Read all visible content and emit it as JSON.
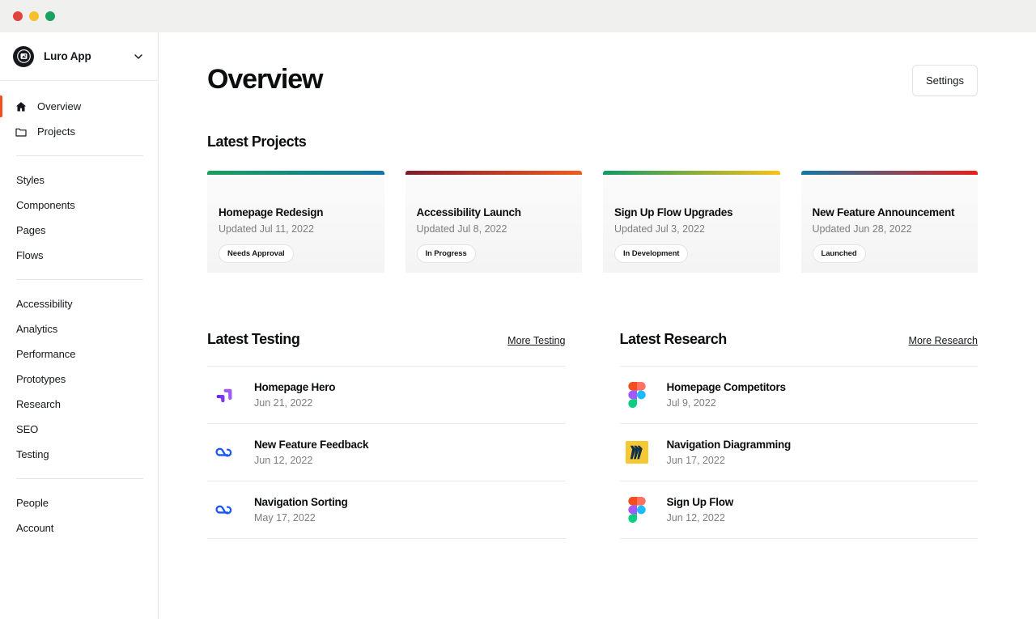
{
  "window": {
    "traffic_lights": [
      "close",
      "minimize",
      "zoom"
    ],
    "colors": {
      "close": "#e0443e",
      "minimize": "#f6c02c",
      "zoom": "#1aa260"
    }
  },
  "sidebar": {
    "brand": {
      "name": "Luro App",
      "logo_icon": "luro-logo-icon",
      "chevron_icon": "chevron-down-icon"
    },
    "primary": [
      {
        "label": "Overview",
        "icon": "home-icon",
        "active": true
      },
      {
        "label": "Projects",
        "icon": "folder-icon",
        "active": false
      }
    ],
    "design_group": [
      {
        "label": "Styles"
      },
      {
        "label": "Components"
      },
      {
        "label": "Pages"
      },
      {
        "label": "Flows"
      }
    ],
    "insights_group": [
      {
        "label": "Accessibility"
      },
      {
        "label": "Analytics"
      },
      {
        "label": "Performance"
      },
      {
        "label": "Prototypes"
      },
      {
        "label": "Research"
      },
      {
        "label": "SEO"
      },
      {
        "label": "Testing"
      }
    ],
    "account_group": [
      {
        "label": "People"
      },
      {
        "label": "Account"
      }
    ],
    "active_accent": "#f24e1e"
  },
  "header": {
    "title": "Overview",
    "settings_label": "Settings"
  },
  "latest_projects": {
    "title": "Latest Projects",
    "cards": [
      {
        "title": "Homepage Redesign",
        "updated": "Updated Jul 11, 2022",
        "status": "Needs Approval",
        "bar_from": "#1a9e5c",
        "bar_to": "#1474a8"
      },
      {
        "title": "Accessibility Launch",
        "updated": "Updated Jul 8, 2022",
        "status": "In Progress",
        "bar_from": "#7e1b2c",
        "bar_to": "#f4591b"
      },
      {
        "title": "Sign Up Flow Upgrades",
        "updated": "Updated Jul 3, 2022",
        "status": "In Development",
        "bar_from": "#0f9b63",
        "bar_to": "#fbc013"
      },
      {
        "title": "New Feature Announcement",
        "updated": "Updated Jun 28, 2022",
        "status": "Launched",
        "bar_from": "#1179a8",
        "bar_to": "#ee1c18"
      }
    ]
  },
  "latest_testing": {
    "title": "Latest Testing",
    "more_label": "More Testing",
    "items": [
      {
        "title": "Homepage Hero",
        "date": "Jun 21, 2022",
        "icon": "maze-icon"
      },
      {
        "title": "New Feature Feedback",
        "date": "Jun 12, 2022",
        "icon": "usertesting-icon"
      },
      {
        "title": "Navigation Sorting",
        "date": "May 17, 2022",
        "icon": "usertesting-icon"
      }
    ]
  },
  "latest_research": {
    "title": "Latest Research",
    "more_label": "More Research",
    "items": [
      {
        "title": "Homepage Competitors",
        "date": "Jul 9, 2022",
        "icon": "figma-icon"
      },
      {
        "title": "Navigation Diagramming",
        "date": "Jun 17, 2022",
        "icon": "miro-icon"
      },
      {
        "title": "Sign Up Flow",
        "date": "Jun 12, 2022",
        "icon": "figma-icon"
      }
    ]
  }
}
